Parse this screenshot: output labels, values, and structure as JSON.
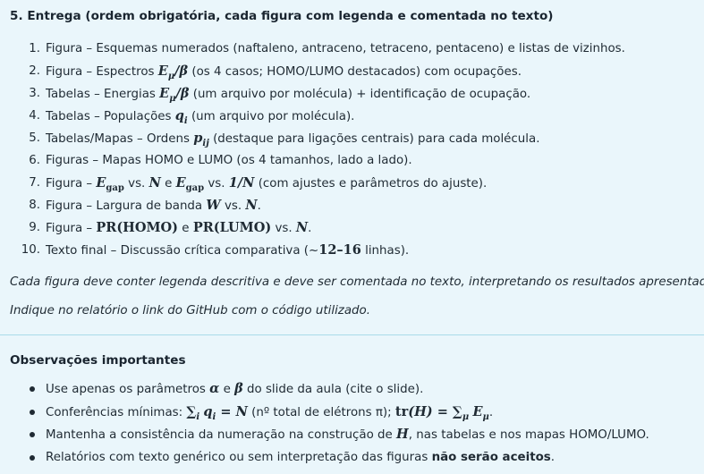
{
  "section_title": "5. Entrega (ordem obrigatória, cada figura com legenda e comentada no texto)",
  "items": [
    {
      "num": "1.",
      "parts": [
        "Figura – Esquemas numerados (naftaleno, antraceno, tetraceno, pentaceno) e listas de vizinhos."
      ]
    },
    {
      "num": "2.",
      "pre": "Figura – Espectros ",
      "math": "E",
      "msub": "μ",
      "math2": "/β",
      "post": " (os 4 casos; HOMO/LUMO destacados) com ocupações."
    },
    {
      "num": "3.",
      "pre": "Tabelas – Energias ",
      "math": "E",
      "msub": "μ",
      "math2": "/β",
      "post": " (um arquivo por molécula) + identificação de ocupação."
    },
    {
      "num": "4.",
      "pre": "Tabelas – Populações ",
      "math": "q",
      "msub": "i",
      "math2": "",
      "post": " (um arquivo por molécula)."
    },
    {
      "num": "5.",
      "pre": "Tabelas/Mapas – Ordens ",
      "math": "p",
      "msub": "ij",
      "math2": "",
      "post": " (destaque para ligações centrais) para cada molécula."
    },
    {
      "num": "6.",
      "parts": [
        "Figuras – Mapas HOMO e LUMO (os 4 tamanhos, lado a lado)."
      ]
    },
    {
      "num": "7.",
      "text7": {
        "a": "Figura – ",
        "m1": "E",
        "s1": "gap",
        "b": " vs. ",
        "m2": "N",
        "c": " e ",
        "m3": "E",
        "s3": "gap",
        "d": " vs. ",
        "m4": "1/N",
        "e": " (com ajustes e parâmetros do ajuste)."
      }
    },
    {
      "num": "8.",
      "text8": {
        "a": "Figura – Largura de banda ",
        "m1": "W",
        "b": " vs. ",
        "m2": "N",
        "c": "."
      }
    },
    {
      "num": "9.",
      "text9": {
        "a": "Figura – ",
        "m1": "PR(HOMO)",
        "b": " e ",
        "m2": "PR(LUMO)",
        "c": " vs. ",
        "m3": "N",
        "d": "."
      }
    },
    {
      "num": "10.",
      "text10": {
        "a": "Texto final – Discussão crítica comparativa (~",
        "m1": "12–16",
        "b": " linhas)."
      }
    }
  ],
  "note1": "Cada figura deve conter legenda descritiva e deve ser comentada no texto, interpretando os resultados apresentados.",
  "note2": "Indique no relatório o link do GitHub com o código utilizado.",
  "obs_title": "Observações importantes",
  "obs": {
    "o1": {
      "a": "Use apenas os parâmetros ",
      "m1": "α",
      "b": " e ",
      "m2": "β",
      "c": " do slide da aula (cite o slide)."
    },
    "o2": {
      "a": "Conferências mínimas: ",
      "sum1": "∑",
      "sum1sub": "i",
      "m1": "q",
      "m1sub": "i",
      "eq1": " = ",
      "m2": "N",
      "b": " (nº total de elétrons π); ",
      "tr": "tr",
      "m3": "(H)",
      "eq2": " = ",
      "sum2": "∑",
      "sum2sub": "μ",
      "m4": "E",
      "m4sub": "μ",
      "c": "."
    },
    "o3": {
      "a": "Mantenha a consistência da numeração na construção de ",
      "m1": "H",
      "b": ", nas tabelas e nos mapas HOMO/LUMO."
    },
    "o4": {
      "a": "Relatórios com texto genérico ou sem interpretação das figuras ",
      "strong": "não serão aceitos",
      "b": "."
    }
  },
  "colors": {
    "background": "#eaf6fb",
    "divider": "#a9dbe9",
    "text": "#1f2a33"
  }
}
